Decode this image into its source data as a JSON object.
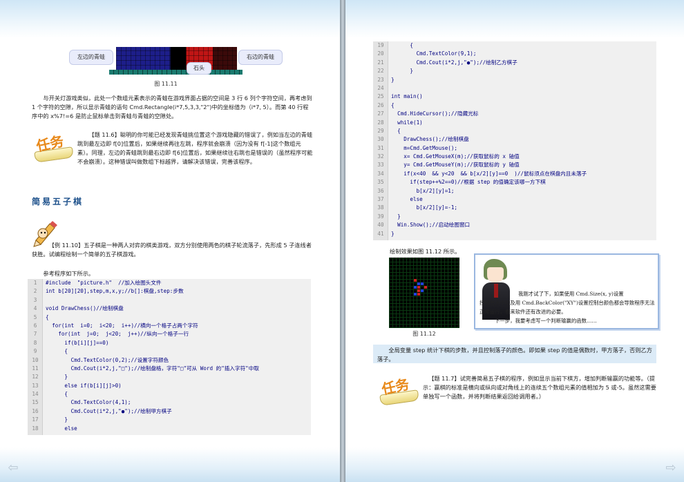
{
  "left_page": {
    "figure_11_11": {
      "callout_left": "左边的青蛙",
      "callout_right": "右边的青蛙",
      "callout_stone": "石头",
      "caption": "图 11.11"
    },
    "paragraph_1": "与开关灯游戏类似，此处一个数组元素表示的青蛙在游戏界面占据的空间是 3 行 6 列个字符空间，再考虑到 1 个字符的空隙，所以显示青蛙的语句 Cmd.Rectangle(i*7,5,3,3,\"2\")中的坐标值为（i*7, 5）。而第 40 行程序中的 x%7!=6 是防止鼠标单击到青蛙与青蛙的空隙处。",
    "task_11_6": "【题 11.6】聪明的你可能已经发现青蛙挑位置这个游戏隐藏的错误了，例如当左边的青蛙跳到最左边即 f[0]位置后，如果继续再往左跳，程序就会崩溃（因为没有 f[-1]这个数组元素）。同理，左边的青蛙跳到最右边即 f[6]位置后，如果继续往右跳也是错误的（虽然程序可能不会崩溃）。这种错误叫做数组下标越界，请解决该错误，完善该程序。",
    "task_label": "任务",
    "section_title": "简易五子棋",
    "example_11_10": "【例 11.10】五子棋是一种两人对弈的棋类游戏，双方分别使用两色的棋子轮流落子，先形成 5 子连线者获胜。试编程绘制一个简单的五子棋游戏。",
    "ref_label": "参考程序如下所示。",
    "code": [
      {
        "n": "1",
        "t": "#include  \"picture.h\"  //加入绘图头文件"
      },
      {
        "n": "2",
        "t": "int b[20][20],step,m,x,y;//b[]:棋盘,step:步数"
      },
      {
        "n": "3",
        "t": ""
      },
      {
        "n": "4",
        "t": "void DrawChess()//绘制棋盘"
      },
      {
        "n": "5",
        "t": "{"
      },
      {
        "n": "6",
        "t": "  for(int  i=0;  i<20;  i++)//横向一个格子占两个字符"
      },
      {
        "n": "7",
        "t": "    for(int  j=0;  j<20;  j++)//纵向一个格子一行"
      },
      {
        "n": "8",
        "t": "      if(b[i][j]==0)"
      },
      {
        "n": "9",
        "t": "      {"
      },
      {
        "n": "10",
        "t": "        Cmd.TextColor(0,2);//设置字符颜色"
      },
      {
        "n": "11",
        "t": "        Cmd.Cout(i*2,j,\"□\");//绘制盘格，字符\"□\"可从 Word 的\"插入字符\"中取"
      },
      {
        "n": "12",
        "t": "      }"
      },
      {
        "n": "13",
        "t": "      else if(b[i][j]>0)"
      },
      {
        "n": "14",
        "t": "      {"
      },
      {
        "n": "15",
        "t": "        Cmd.TextColor(4,1);"
      },
      {
        "n": "16",
        "t": "        Cmd.Cout(i*2,j,\"●\");//绘制甲方棋子"
      },
      {
        "n": "17",
        "t": "      }"
      },
      {
        "n": "18",
        "t": "      else"
      }
    ]
  },
  "right_page": {
    "code": [
      {
        "n": "19",
        "t": "      {"
      },
      {
        "n": "20",
        "t": "        Cmd.TextColor(9,1);"
      },
      {
        "n": "21",
        "t": "        Cmd.Cout(i*2,j,\"●\");//绘制乙方棋子"
      },
      {
        "n": "22",
        "t": "      }"
      },
      {
        "n": "23",
        "t": "}"
      },
      {
        "n": "24",
        "t": ""
      },
      {
        "n": "25",
        "t": "int main()"
      },
      {
        "n": "26",
        "t": "{"
      },
      {
        "n": "27",
        "t": "  Cmd.HideCursor();//隐藏光标"
      },
      {
        "n": "28",
        "t": "  while(1)"
      },
      {
        "n": "29",
        "t": "  {"
      },
      {
        "n": "30",
        "t": "    DrawChess();//绘制棋盘"
      },
      {
        "n": "31",
        "t": "    m=Cmd.GetMouse();"
      },
      {
        "n": "32",
        "t": "    x= Cmd.GetMouseX(m);//获取鼠标的 x 轴值"
      },
      {
        "n": "33",
        "t": "    y= Cmd.GetMouseY(m);//获取鼠标的 y 轴值"
      },
      {
        "n": "34",
        "t": "    if(x<40  && y<20  && b[x/2][y]==0  )//鼠标须点在棋盘内且未落子"
      },
      {
        "n": "35",
        "t": "      if(step++%2==0)//根据 step 的值确定该哪一方下棋"
      },
      {
        "n": "36",
        "t": "        b[x/2][y]=1;"
      },
      {
        "n": "37",
        "t": "      else"
      },
      {
        "n": "38",
        "t": "        b[x/2][y]=-1;"
      },
      {
        "n": "39",
        "t": "  }"
      },
      {
        "n": "40",
        "t": "  Win.Show();//启动绘图窗口"
      },
      {
        "n": "41",
        "t": "}"
      }
    ],
    "effect_label": "绘制效果如图 11.12 所示。",
    "figure_caption": "图 11.12",
    "character_text_1": "我刚才试了下，如果使用 Cmd.Size(x, y)设置",
    "character_text_2": "控制台大小以及用 Cmd.BackColor(\"XY\")设置控制台颜色都会导致程序无法正常运行，看来软件还有改进的必要。",
    "character_text_3": "下一步，我要考虑写一个判断输赢的函数……",
    "paragraph_step": "全局变量 step 统计下棋的步数，并且控制落子的颜色。即如果 step 的值是偶数时，甲方落子，否则乙方落子。",
    "task_label": "任务",
    "task_11_7": "【题 11.7】试完善简易五子棋的程序，例如显示当前下棋方，增加判断输赢的功能等。（提示：赢棋的标准是横向或纵向或对角线上的连续五个数组元素的值相加为 5 或-5。虽然这需要单独写一个函数，并将判断结果返回给调用者。）"
  },
  "nav": {
    "prev_icon": "left-arrow-icon",
    "next_icon": "right-arrow-icon"
  }
}
